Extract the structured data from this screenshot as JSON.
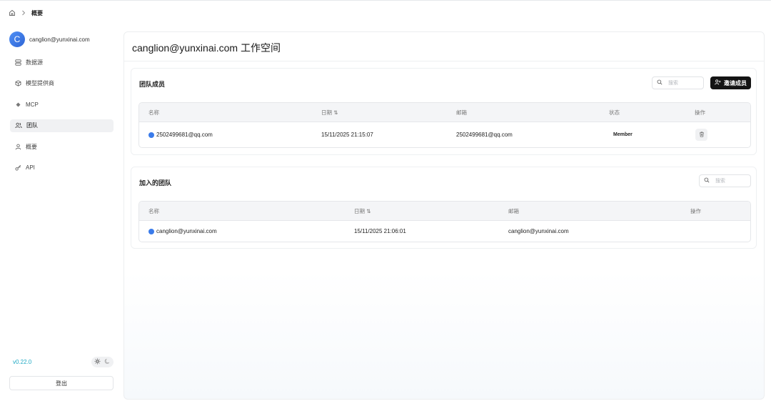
{
  "breadcrumb": {
    "current": "概要"
  },
  "user": {
    "avatar_letter": "C",
    "email": "canglion@yunxinai.com"
  },
  "sidebar": {
    "items": [
      {
        "label": "数据源",
        "icon": "database-icon"
      },
      {
        "label": "模型提供商",
        "icon": "cube-icon"
      },
      {
        "label": "MCP",
        "icon": "mcp-icon"
      },
      {
        "label": "团队",
        "icon": "users-icon",
        "active": true
      },
      {
        "label": "概要",
        "icon": "user-icon"
      },
      {
        "label": "API",
        "icon": "key-icon"
      }
    ],
    "version": "v0.22.0",
    "logout_label": "登出"
  },
  "main": {
    "title": "canglion@yunxinai.com 工作空间",
    "team_members": {
      "title": "团队成员",
      "search_placeholder": "搜索",
      "invite_label": "邀请成员",
      "columns": {
        "name": "名称",
        "date": "日期 ⇅",
        "email": "邮箱",
        "status": "状态",
        "action": "操作"
      },
      "rows": [
        {
          "name": "2502499681@qq.com",
          "date": "15/11/2025 21:15:07",
          "email": "2502499681@qq.com",
          "status": "Member"
        }
      ]
    },
    "joined_teams": {
      "title": "加入的团队",
      "search_placeholder": "搜索",
      "columns": {
        "name": "名称",
        "date": "日期 ⇅",
        "email": "邮箱",
        "action": "操作"
      },
      "rows": [
        {
          "name": "canglion@yunxinai.com",
          "date": "15/11/2025 21:06:01",
          "email": "canglion@yunxinai.com"
        }
      ]
    }
  },
  "colors": {
    "accent_dark": "#141414",
    "version_color": "#20a9c4",
    "avatar_blue": "#3a7bea"
  }
}
